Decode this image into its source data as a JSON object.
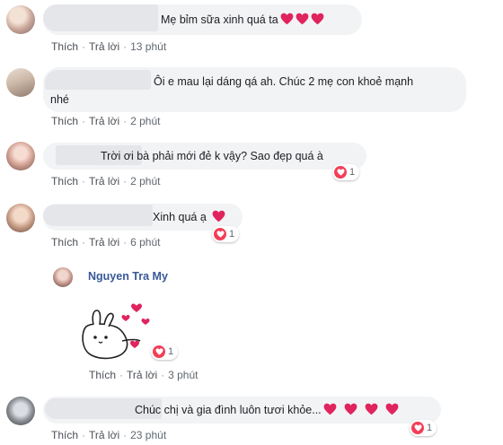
{
  "comments": [
    {
      "text": "Mẹ bỉm sữa xinh quá ta",
      "hearts": 3,
      "actions": {
        "like": "Thích",
        "reply": "Trả lời",
        "time": "13 phút"
      }
    },
    {
      "text_line1": "Ôi e mau lại dáng qá ah. Chúc 2 mẹ con khoẻ mạnh",
      "text_line2": "nhé",
      "actions": {
        "like": "Thích",
        "reply": "Trả lời",
        "time": "2 phút"
      }
    },
    {
      "text": "Trời ơi bà phải mới đẻ k vậy? Sao đẹp quá à",
      "reaction_count": "1",
      "actions": {
        "like": "Thích",
        "reply": "Trả lời",
        "time": "2 phút"
      }
    },
    {
      "text": "Xinh quá ạ",
      "hearts": 1,
      "reaction_count": "1",
      "actions": {
        "like": "Thích",
        "reply": "Trả lời",
        "time": "6 phút"
      }
    },
    {
      "author": "Nguyen Tra My",
      "sticker": "bunny-hearts-sticker",
      "reaction_count": "1",
      "actions": {
        "like": "Thích",
        "reply": "Trả lời",
        "time": "3 phút"
      }
    },
    {
      "text": "Chúc chị và gia đình luôn tươi khỏe...",
      "hearts": 4,
      "reaction_count": "1",
      "actions": {
        "like": "Thích",
        "reply": "Trả lời",
        "time": "23 phút"
      }
    }
  ],
  "colors": {
    "bubble": "#f2f3f5",
    "name": "#385898",
    "heart": "#e0245e",
    "action": "#606770"
  }
}
